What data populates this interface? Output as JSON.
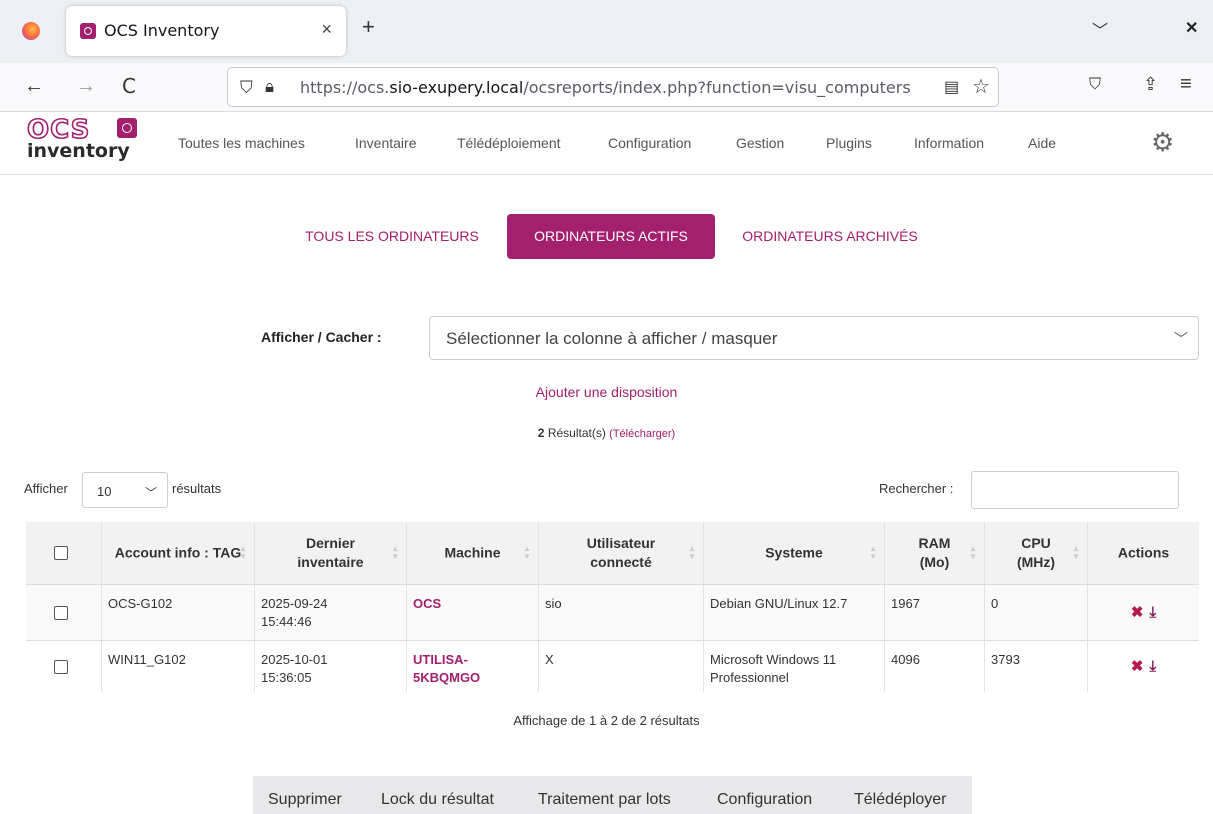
{
  "browser": {
    "tab_title": "OCS Inventory",
    "tab_close": "×",
    "new_tab": "+",
    "tab_list": "﹀",
    "close": "✕",
    "back": "←",
    "forward": "→",
    "reload": "C",
    "url_prefix": "https://ocs.",
    "url_domain": "sio-exupery.local",
    "url_path": "/ocsreports/index.php?function=visu_computers",
    "icons": {
      "shield": "shield-icon",
      "lock": "lock-icon",
      "reader": "reader-view-icon",
      "star": "bookmark-star-icon",
      "pocket": "pocket-icon",
      "share": "share-icon",
      "menu": "hamburger-menu-icon"
    }
  },
  "app": {
    "logo_top": "OCS",
    "logo_bottom": "inventory",
    "menu": [
      "Toutes les machines",
      "Inventaire",
      "Télédéploiement",
      "Configuration",
      "Gestion",
      "Plugins",
      "Information",
      "Aide"
    ],
    "accent": "#a3206f"
  },
  "tabs": [
    "TOUS LES ORDINATEURS",
    "ORDINATEURS ACTIFS",
    "ORDINATEURS ARCHIVÉS"
  ],
  "active_tab": 1,
  "column_selector": {
    "label": "Afficher / Cacher :",
    "placeholder": "Sélectionner la colonne à afficher / masquer"
  },
  "add_layout": "Ajouter une disposition",
  "results": {
    "count": "2",
    "label": "Résultat(s)",
    "download": "(Télécharger)"
  },
  "length": {
    "prefix": "Afficher",
    "value": "10",
    "suffix": "résultats"
  },
  "search": {
    "label": "Rechercher :",
    "value": ""
  },
  "table": {
    "headers": [
      "",
      "Account info : TAG",
      "Dernier inventaire",
      "Machine",
      "Utilisateur connecté",
      "Systeme",
      "RAM (Mo)",
      "CPU (MHz)",
      "Actions"
    ],
    "rows": [
      {
        "tag": "OCS-G102",
        "last_inventory": "2025-09-24 15:44:46",
        "machine": "OCS",
        "user": "sio",
        "system": "Debian GNU/Linux 12.7",
        "ram": "1967",
        "cpu": "0"
      },
      {
        "tag": "WIN11_G102",
        "last_inventory": "2025-10-01 15:36:05",
        "machine": "UTILISA-5KBQMGO",
        "user": "X",
        "system": "Microsoft Windows 11 Professionnel",
        "ram": "4096",
        "cpu": "3793"
      }
    ],
    "info": "Affichage de 1 à 2 de 2 résultats"
  },
  "bulk_actions": [
    "Supprimer",
    "Lock du résultat",
    "Traitement par lots",
    "Configuration",
    "Télédéployer"
  ]
}
